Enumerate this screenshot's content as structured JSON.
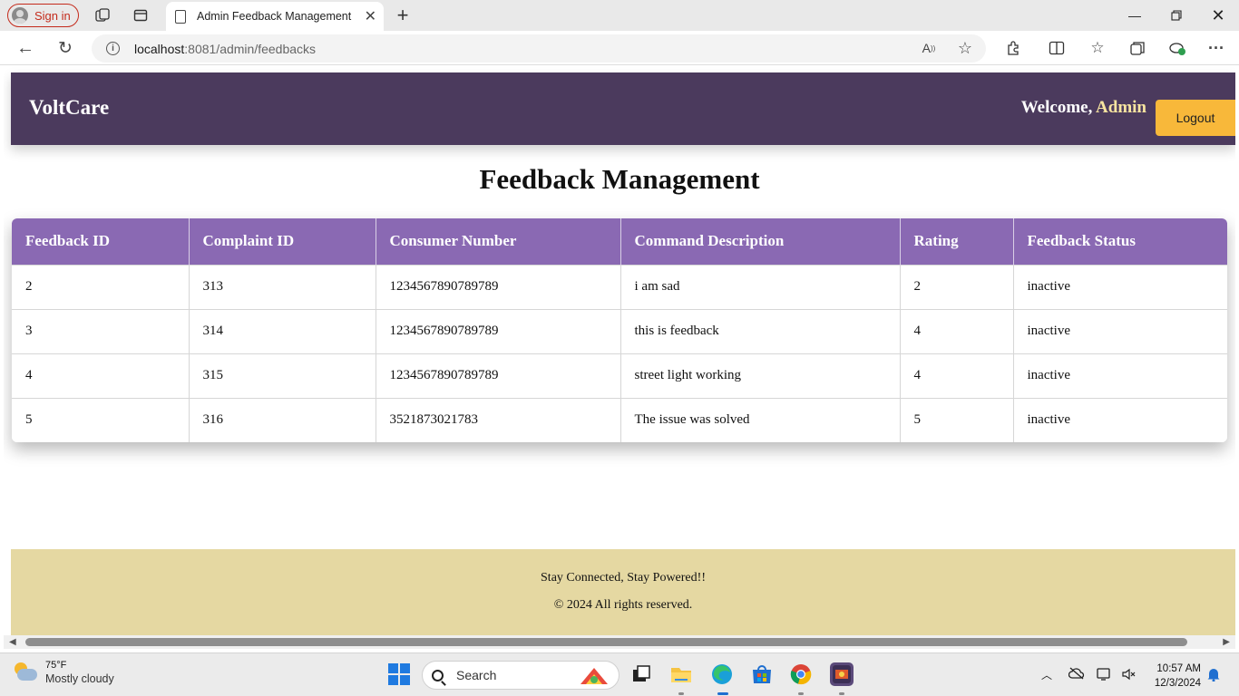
{
  "browser": {
    "signin_label": "Sign in",
    "tab_title": "Admin Feedback Management",
    "url_host": "localhost",
    "url_path": ":8081/admin/feedbacks"
  },
  "header": {
    "brand": "VoltCare",
    "welcome_prefix": "Welcome,",
    "welcome_user": "Admin",
    "logout_label": "Logout"
  },
  "page": {
    "title": "Feedback Management"
  },
  "table": {
    "columns": [
      "Feedback ID",
      "Complaint ID",
      "Consumer Number",
      "Command Description",
      "Rating",
      "Feedback Status"
    ],
    "rows": [
      [
        "2",
        "313",
        "1234567890789789",
        "i am sad",
        "2",
        "inactive"
      ],
      [
        "3",
        "314",
        "1234567890789789",
        "this is feedback",
        "4",
        "inactive"
      ],
      [
        "4",
        "315",
        "1234567890789789",
        "street light working",
        "4",
        "inactive"
      ],
      [
        "5",
        "316",
        "3521873021783",
        "The issue was solved",
        "5",
        "inactive"
      ]
    ]
  },
  "footer": {
    "line1": "Stay Connected, Stay Powered!!",
    "line2": "© 2024 All rights reserved."
  },
  "taskbar": {
    "weather_temp": "75°F",
    "weather_condition": "Mostly cloudy",
    "search_placeholder": "Search",
    "time": "10:57 AM",
    "date": "12/3/2024"
  },
  "colors": {
    "header_bg": "#4b3a5d",
    "table_header_bg": "#8a69b3",
    "logout_bg": "#f8b83a",
    "footer_bg": "#e5d8a2",
    "welcome_user": "#f8e5a0"
  }
}
